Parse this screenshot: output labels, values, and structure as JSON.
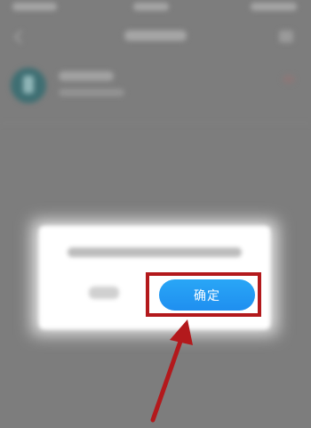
{
  "dialog": {
    "confirm_label": "确定"
  },
  "colors": {
    "overlay": "#7d7d7d",
    "dialog_bg": "#ffffff",
    "confirm_button": "#1f8ff0",
    "highlight": "#b3191c"
  },
  "icons": [
    "back-icon",
    "settings-icon",
    "avatar",
    "arrow-pointer"
  ]
}
